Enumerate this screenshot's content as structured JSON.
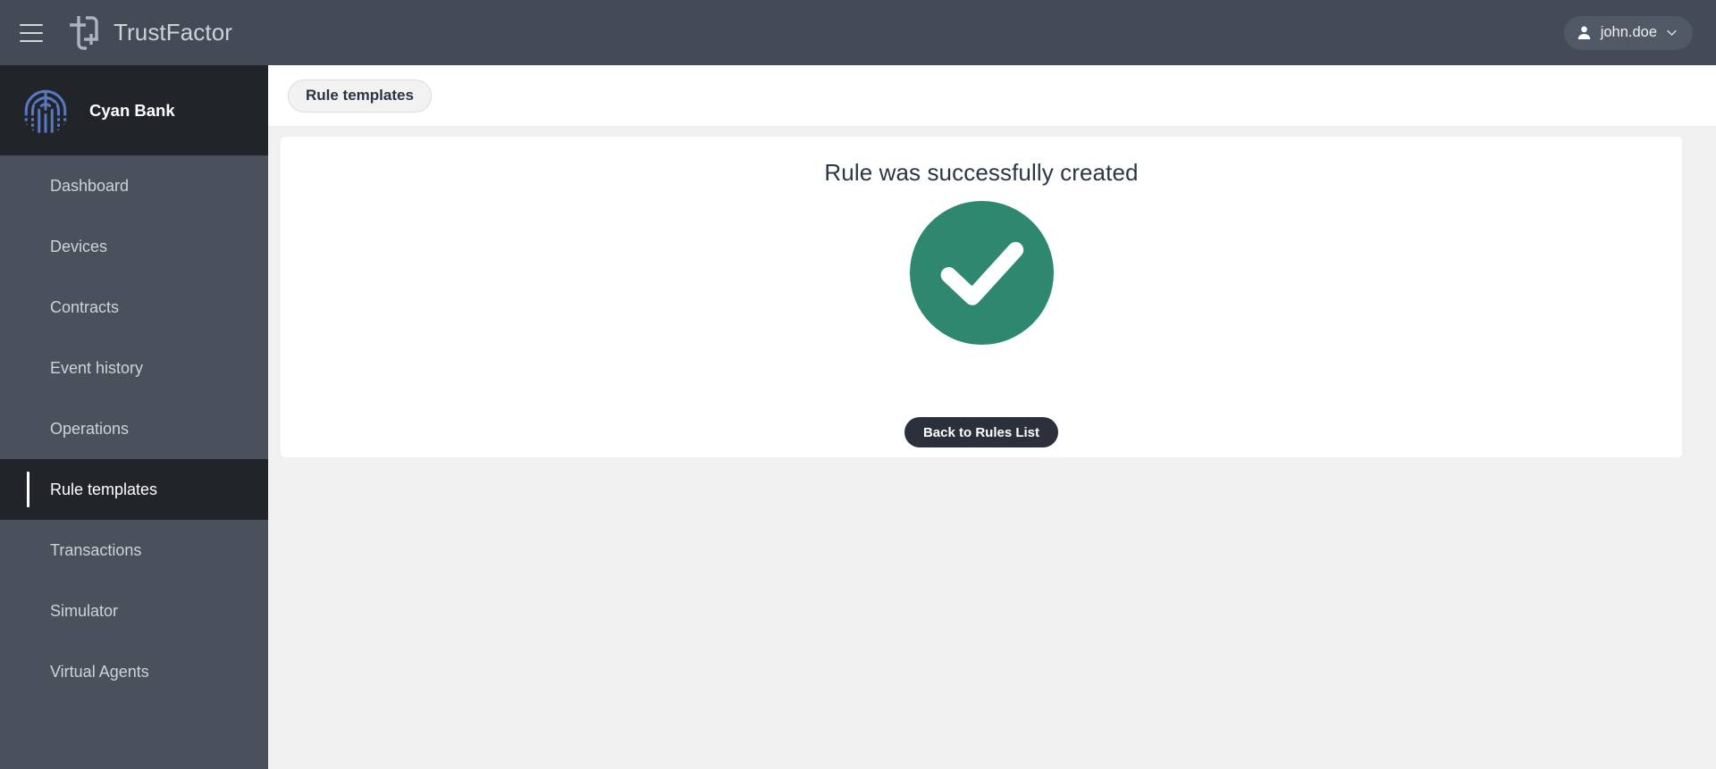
{
  "topbar": {
    "menu_icon": "hamburger-icon",
    "logo_icon": "trustfactor-logo-icon",
    "app_name": "TrustFactor",
    "user": {
      "avatar_icon": "user-avatar-icon",
      "name": "john.doe",
      "chevron_icon": "chevron-down-icon"
    },
    "bg_color": "#444b57"
  },
  "sidebar": {
    "org": {
      "logo_icon": "cyan-bank-logo-icon",
      "name": "Cyan Bank",
      "logo_color": "#5878c0",
      "bg_color": "#212529"
    },
    "bg_color": "#4a505c",
    "active_bg_color": "#212529",
    "items": [
      {
        "label": "Dashboard",
        "active": false
      },
      {
        "label": "Devices",
        "active": false
      },
      {
        "label": "Contracts",
        "active": false
      },
      {
        "label": "Event history",
        "active": false
      },
      {
        "label": "Operations",
        "active": false
      },
      {
        "label": "Rule templates",
        "active": true
      },
      {
        "label": "Transactions",
        "active": false
      },
      {
        "label": "Simulator",
        "active": false
      },
      {
        "label": "Virtual Agents",
        "active": false
      }
    ]
  },
  "breadcrumb": {
    "items": [
      {
        "label": "Rule templates"
      }
    ]
  },
  "main": {
    "success": {
      "title": "Rule was successfully created",
      "icon": "success-check-circle-icon",
      "icon_color": "#2e8870",
      "check_color": "#ffffff",
      "button_label": "Back to Rules List",
      "button_color": "#2b303b"
    }
  }
}
